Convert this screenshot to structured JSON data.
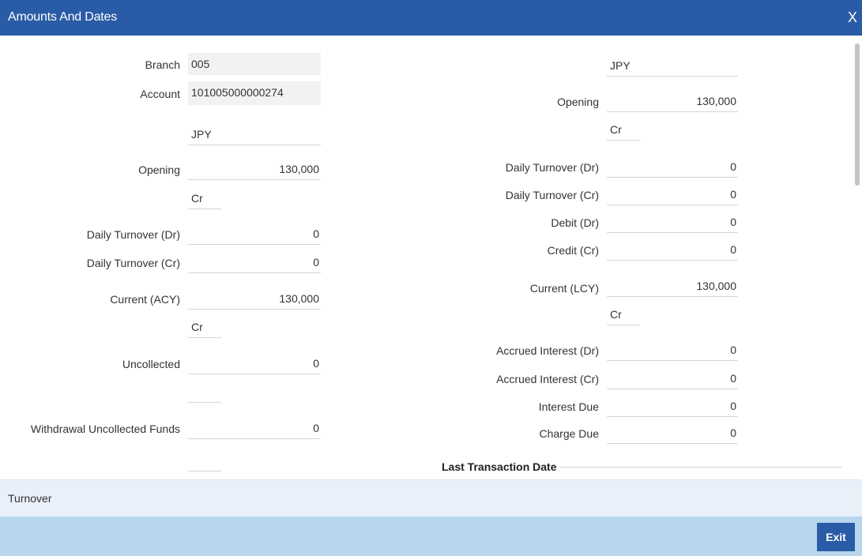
{
  "window": {
    "title": "Amounts And Dates",
    "close_glyph": "X"
  },
  "left": {
    "branch_label": "Branch",
    "branch_value": "005",
    "account_label": "Account",
    "account_value": "101005000000274",
    "currency_value": "JPY",
    "opening_label": "Opening",
    "opening_value": "130,000",
    "opening_indicator": "Cr",
    "daily_dr_label": "Daily Turnover (Dr)",
    "daily_dr_value": "0",
    "daily_cr_label": "Daily Turnover (Cr)",
    "daily_cr_value": "0",
    "current_acy_label": "Current (ACY)",
    "current_acy_value": "130,000",
    "current_acy_indicator": "Cr",
    "uncollected_label": "Uncollected",
    "uncollected_value": "0",
    "uncollected_indicator": "",
    "withdrawal_label": "Withdrawal Uncollected Funds",
    "withdrawal_value": "0",
    "withdrawal_indicator": ""
  },
  "right": {
    "currency_value": "JPY",
    "opening_label": "Opening",
    "opening_value": "130,000",
    "opening_indicator": "Cr",
    "daily_dr_label": "Daily Turnover (Dr)",
    "daily_dr_value": "0",
    "daily_cr_label": "Daily Turnover (Cr)",
    "daily_cr_value": "0",
    "debit_label": "Debit (Dr)",
    "debit_value": "0",
    "credit_label": "Credit (Cr)",
    "credit_value": "0",
    "current_lcy_label": "Current (LCY)",
    "current_lcy_value": "130,000",
    "current_lcy_indicator": "Cr",
    "accrued_dr_label": "Accrued Interest (Dr)",
    "accrued_dr_value": "0",
    "accrued_cr_label": "Accrued Interest (Cr)",
    "accrued_cr_value": "0",
    "interest_due_label": "Interest Due",
    "interest_due_value": "0",
    "charge_due_label": "Charge Due",
    "charge_due_value": "0"
  },
  "section": {
    "last_transaction_title": "Last Transaction Date"
  },
  "tabs": [
    {
      "label": "Turnover"
    }
  ],
  "footer": {
    "exit_label": "Exit"
  },
  "colors": {
    "titlebar": "#2a5ba6",
    "tabbar": "#e9f0fa",
    "footer": "#b8d5ee",
    "button": "#2a5ba6"
  }
}
